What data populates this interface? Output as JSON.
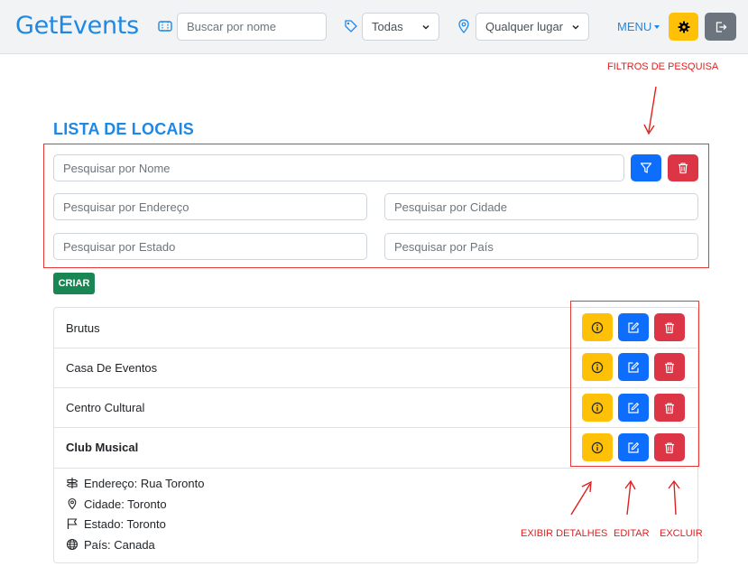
{
  "navbar": {
    "brand": "GetEvents",
    "search_placeholder": "Buscar por nome",
    "category_value": "Todas",
    "location_value": "Qualquer lugar",
    "menu_label": "MENU"
  },
  "annotations": {
    "filters": "FILTROS DE PESQUISA",
    "details": "EXIBIR DETALHES",
    "edit": "EDITAR",
    "delete": "EXCLUIR"
  },
  "page": {
    "title": "LISTA DE LOCAIS",
    "create_label": "CRIAR"
  },
  "filters": {
    "name_placeholder": "Pesquisar por Nome",
    "address_placeholder": "Pesquisar por Endereço",
    "city_placeholder": "Pesquisar por Cidade",
    "state_placeholder": "Pesquisar por Estado",
    "country_placeholder": "Pesquisar por País"
  },
  "places": [
    {
      "name": "Brutus"
    },
    {
      "name": "Casa De Eventos"
    },
    {
      "name": "Centro Cultural"
    },
    {
      "name": "Club Musical"
    }
  ],
  "expanded": {
    "address": "Endereço: Rua Toronto",
    "city": "Cidade: Toronto",
    "state": "Estado: Toronto",
    "country": "País: Canada"
  },
  "colors": {
    "brand": "#1e88e5",
    "primary": "#0d6efd",
    "danger": "#dc3545",
    "warning": "#ffc107",
    "success": "#198754",
    "annotation": "#e02020"
  },
  "icons": [
    "ticket-icon",
    "tag-icon",
    "location-pin-icon",
    "chevron-down-icon",
    "gear-icon",
    "logout-icon",
    "filter-icon",
    "trash-icon",
    "info-icon",
    "edit-icon",
    "signpost-icon",
    "flag-icon",
    "globe-icon"
  ]
}
